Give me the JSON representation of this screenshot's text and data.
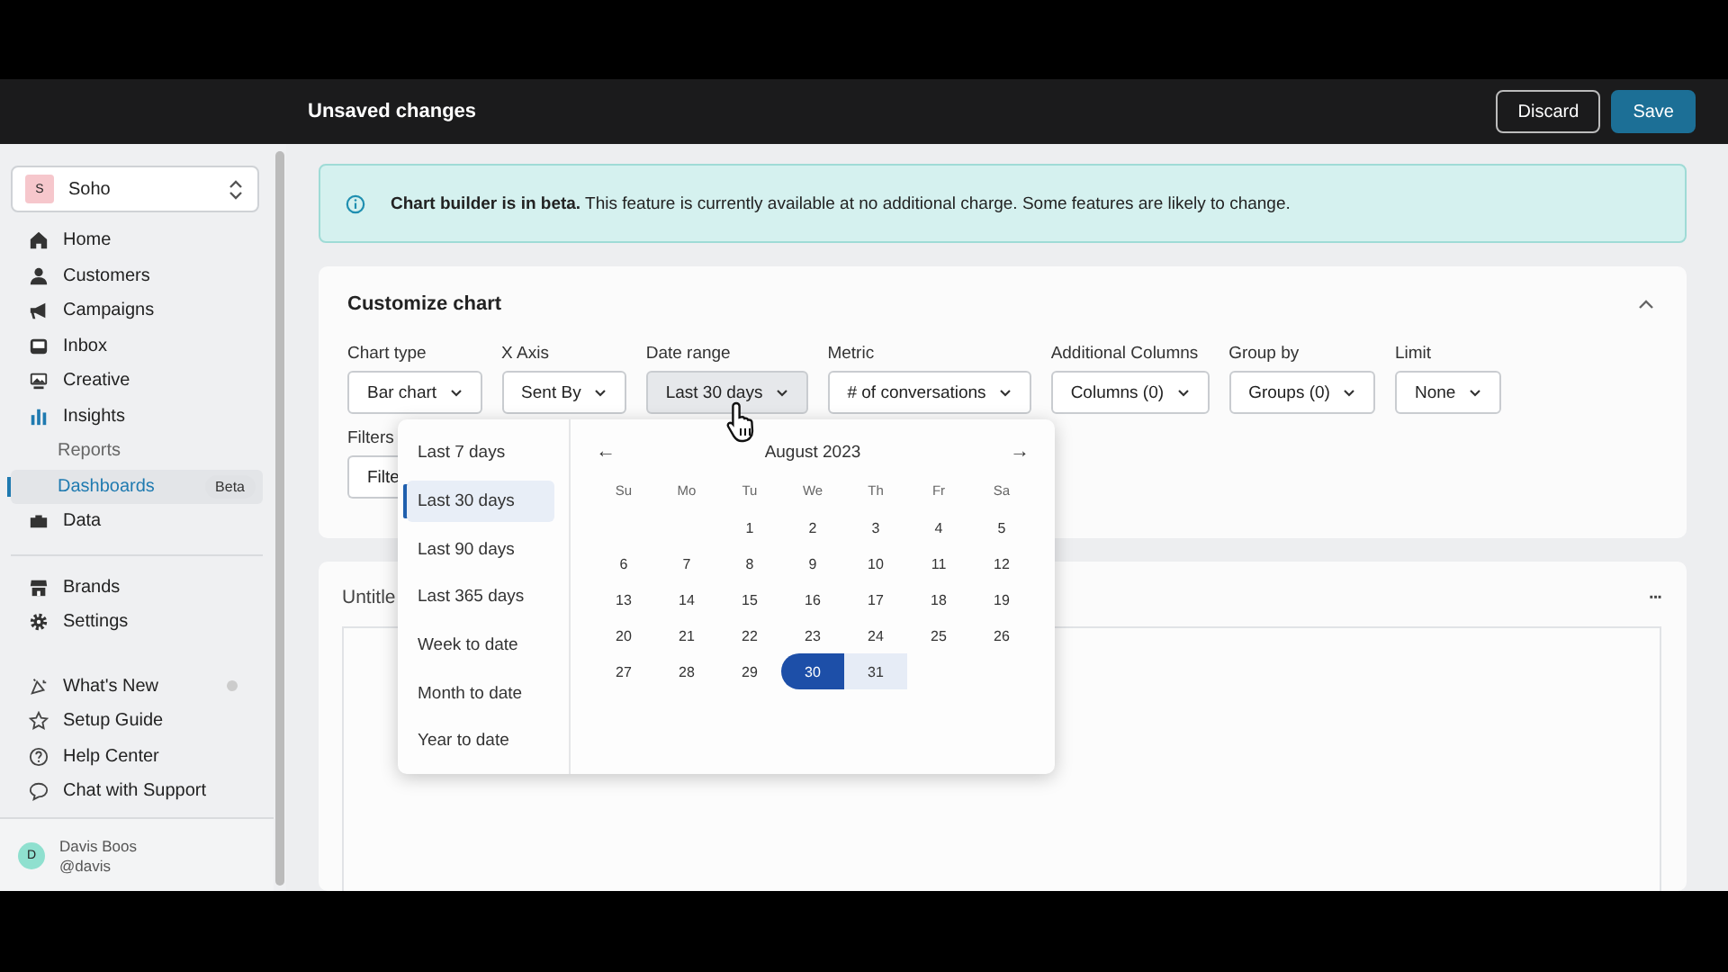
{
  "topbar": {
    "title": "Unsaved changes",
    "buttons": [
      {
        "label": "Discard",
        "kind": "secondary"
      },
      {
        "label": "Save",
        "kind": "primary"
      }
    ]
  },
  "sidebar": {
    "workspace": {
      "initial": "S",
      "name": "Soho"
    },
    "groups": [
      {
        "items": [
          {
            "label": "Home",
            "kind": "item",
            "selected": false
          },
          {
            "label": "Customers",
            "kind": "item",
            "selected": false
          },
          {
            "label": "Campaigns",
            "kind": "item",
            "selected": false
          },
          {
            "label": "Inbox",
            "kind": "item",
            "selected": false
          },
          {
            "label": "Creative",
            "kind": "item",
            "selected": false
          },
          {
            "label": "Insights",
            "kind": "item",
            "selected": false
          },
          {
            "label": "Reports",
            "kind": "sub",
            "selected": false
          },
          {
            "label": "Dashboards",
            "kind": "sub",
            "selected": true,
            "badge": "Beta"
          },
          {
            "label": "Data",
            "kind": "item",
            "selected": false
          }
        ]
      },
      {
        "items": [
          {
            "label": "Brands",
            "kind": "item",
            "selected": false
          },
          {
            "label": "Settings",
            "kind": "item",
            "selected": false
          }
        ]
      },
      {
        "items": [
          {
            "label": "What's New",
            "kind": "item",
            "selected": false,
            "dot": true
          },
          {
            "label": "Setup Guide",
            "kind": "item",
            "selected": false
          },
          {
            "label": "Help Center",
            "kind": "item",
            "selected": false
          },
          {
            "label": "Chat with Support",
            "kind": "item",
            "selected": false
          }
        ]
      }
    ],
    "user": {
      "initial": "D",
      "name": "Davis Boos",
      "handle": "@davis"
    }
  },
  "banner": {
    "bold": "Chart builder is in beta.",
    "text": "This feature is currently available at no additional charge. Some features are likely to change."
  },
  "customize": {
    "title": "Customize chart",
    "expanded": true,
    "fields": [
      {
        "label": "Chart type",
        "value": "Bar chart",
        "active": false
      },
      {
        "label": "X Axis",
        "value": "Sent By",
        "active": false
      },
      {
        "label": "Date range",
        "value": "Last 30 days",
        "active": true
      },
      {
        "label": "Metric",
        "value": "# of conversations",
        "active": false
      },
      {
        "label": "Additional Columns",
        "value": "Columns (0)",
        "active": false
      },
      {
        "label": "Group by",
        "value": "Groups (0)",
        "active": false
      },
      {
        "label": "Limit",
        "value": "None",
        "active": false
      }
    ],
    "filters": {
      "label": "Filters",
      "button": "Filte"
    }
  },
  "chart_card": {
    "title": "Untitle",
    "menu": "···"
  },
  "date_popup": {
    "presets": [
      {
        "label": "Last 7 days",
        "selected": false
      },
      {
        "label": "Last 30 days",
        "selected": true
      },
      {
        "label": "Last 90 days",
        "selected": false
      },
      {
        "label": "Last 365 days",
        "selected": false
      },
      {
        "label": "Week to date",
        "selected": false
      },
      {
        "label": "Month to date",
        "selected": false
      },
      {
        "label": "Year to date",
        "selected": false
      }
    ],
    "month": "August 2023",
    "prev": "←",
    "next": "→",
    "weekdays": [
      "Su",
      "Mo",
      "Tu",
      "We",
      "Th",
      "Fr",
      "Sa"
    ],
    "weeks": [
      [
        {
          "day": "1",
          "selected": false,
          "in_range": false
        },
        {
          "day": "2",
          "selected": false,
          "in_range": false
        },
        {
          "day": "3",
          "selected": false,
          "in_range": false
        },
        {
          "day": "4",
          "selected": false,
          "in_range": false
        },
        {
          "day": "5",
          "selected": false,
          "in_range": false
        }
      ],
      [
        {
          "day": "6",
          "selected": false,
          "in_range": false
        },
        {
          "day": "7",
          "selected": false,
          "in_range": false
        },
        {
          "day": "8",
          "selected": false,
          "in_range": false
        },
        {
          "day": "9",
          "selected": false,
          "in_range": false
        },
        {
          "day": "10",
          "selected": false,
          "in_range": false
        },
        {
          "day": "11",
          "selected": false,
          "in_range": false
        },
        {
          "day": "12",
          "selected": false,
          "in_range": false
        }
      ],
      [
        {
          "day": "13",
          "selected": false,
          "in_range": false
        },
        {
          "day": "14",
          "selected": false,
          "in_range": false
        },
        {
          "day": "15",
          "selected": false,
          "in_range": false
        },
        {
          "day": "16",
          "selected": false,
          "in_range": false
        },
        {
          "day": "17",
          "selected": false,
          "in_range": false
        },
        {
          "day": "18",
          "selected": false,
          "in_range": false
        },
        {
          "day": "19",
          "selected": false,
          "in_range": false
        }
      ],
      [
        {
          "day": "20",
          "selected": false,
          "in_range": false
        },
        {
          "day": "21",
          "selected": false,
          "in_range": false
        },
        {
          "day": "22",
          "selected": false,
          "in_range": false
        },
        {
          "day": "23",
          "selected": false,
          "in_range": false
        },
        {
          "day": "24",
          "selected": false,
          "in_range": false
        },
        {
          "day": "25",
          "selected": false,
          "in_range": false
        },
        {
          "day": "26",
          "selected": false,
          "in_range": false
        }
      ],
      [
        {
          "day": "27",
          "selected": false,
          "in_range": false
        },
        {
          "day": "28",
          "selected": false,
          "in_range": false
        },
        {
          "day": "29",
          "selected": false,
          "in_range": false
        },
        {
          "day": "30",
          "selected": true,
          "in_range": false
        },
        {
          "day": "31",
          "selected": false,
          "in_range": true
        }
      ]
    ]
  }
}
